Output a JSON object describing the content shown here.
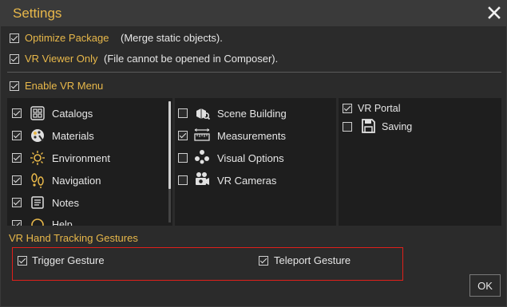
{
  "dialog": {
    "title": "Settings",
    "close_icon": "close-icon"
  },
  "options": {
    "optimize_package": {
      "label": "Optimize Package",
      "note": "(Merge static objects).",
      "checked": true
    },
    "vr_viewer_only": {
      "label": "VR Viewer Only",
      "note": "(File cannot be opened in Composer).",
      "checked": true
    },
    "enable_vr_menu": {
      "label": "Enable VR Menu",
      "checked": true
    }
  },
  "vr_menu": {
    "column1": [
      {
        "label": "Catalogs",
        "icon": "catalogs-icon",
        "checked": true
      },
      {
        "label": "Materials",
        "icon": "materials-icon",
        "checked": true
      },
      {
        "label": "Environment",
        "icon": "environment-icon",
        "checked": true
      },
      {
        "label": "Navigation",
        "icon": "navigation-icon",
        "checked": true
      },
      {
        "label": "Notes",
        "icon": "notes-icon",
        "checked": true
      },
      {
        "label": "Help",
        "icon": "help-icon",
        "checked": true
      }
    ],
    "column2": [
      {
        "label": "Scene Building",
        "icon": "scene-building-icon",
        "checked": false
      },
      {
        "label": "Measurements",
        "icon": "measurements-icon",
        "checked": true
      },
      {
        "label": "Visual Options",
        "icon": "visual-options-icon",
        "checked": false
      },
      {
        "label": "VR Cameras",
        "icon": "vr-cameras-icon",
        "checked": false
      }
    ],
    "column3": [
      {
        "label": "VR Portal",
        "icon": "",
        "checked": true
      },
      {
        "label": "Saving",
        "icon": "saving-icon",
        "checked": false
      }
    ]
  },
  "gestures": {
    "section_title": "VR Hand Tracking Gestures",
    "trigger": {
      "label": "Trigger Gesture",
      "checked": true
    },
    "teleport": {
      "label": "Teleport Gesture",
      "checked": true
    }
  },
  "buttons": {
    "ok": "OK"
  },
  "colors": {
    "accent": "#e8b84a",
    "highlight": "#e0201a",
    "panel": "#1e1e1e",
    "background": "#2b2b2b"
  }
}
